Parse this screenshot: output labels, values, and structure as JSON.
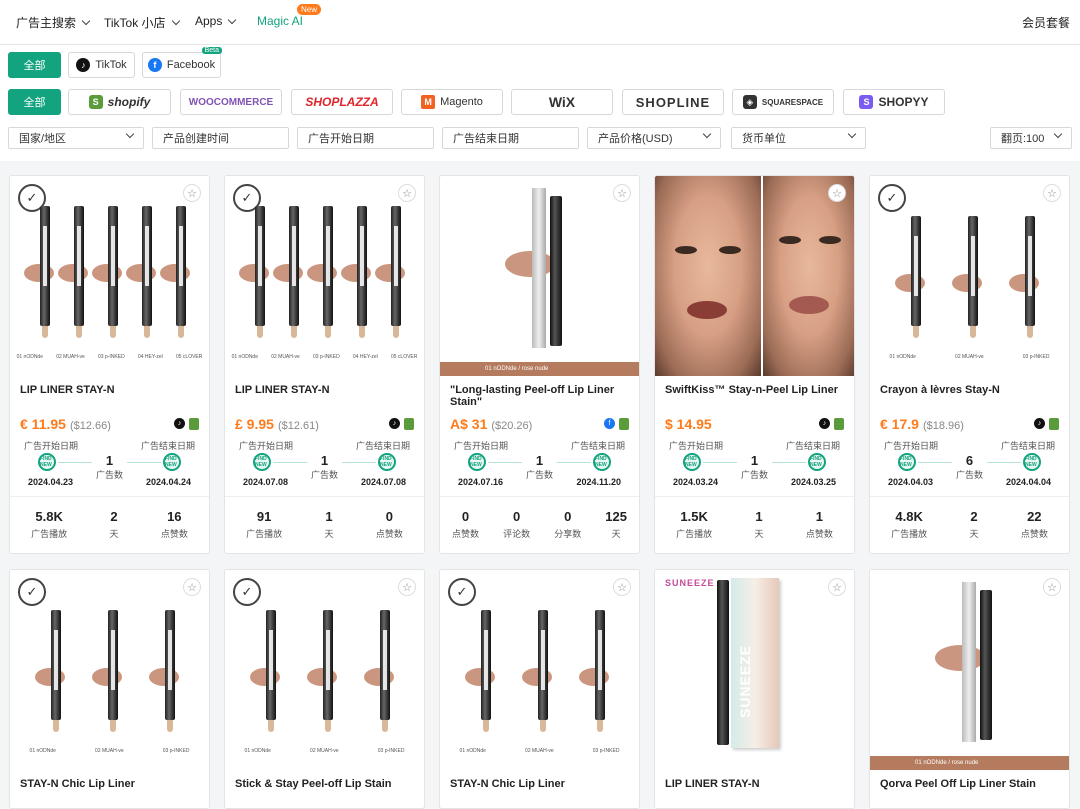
{
  "nav": {
    "items": [
      {
        "label": "广告主搜索"
      },
      {
        "label": "TikTok 小店"
      },
      {
        "label": "Apps"
      },
      {
        "label": "Magic AI"
      }
    ],
    "new_badge": "New",
    "member": "会员套餐"
  },
  "filters": {
    "platform_all": "全部",
    "tiktok": "TikTok",
    "facebook": "Facebook",
    "beta": "Beta",
    "store_all": "全部",
    "stores": [
      "shopify",
      "WOOCOMMERCE",
      "SHOPLAZZA",
      "Magento",
      "WiX",
      "SHOPLINE",
      "SQUARESPACE",
      "SHOPYY"
    ],
    "selects": {
      "region": "国家/地区",
      "created": "产品创建时间",
      "ad_start": "广告开始日期",
      "ad_end": "广告结束日期",
      "price": "产品价格(USD)",
      "currency": "货币单位",
      "per_page": "翻页:100"
    }
  },
  "colors": {
    "accent": "#14a37f",
    "price": "#ff7a1a"
  },
  "labels": {
    "start": "广告开始日期",
    "end": "广告结束日期",
    "ads": "广告数",
    "badge": "FIND NEW"
  },
  "cards": [
    {
      "title": "LIP LINER STAY-N",
      "price": "€ 11.95",
      "orig": "($12.66)",
      "plat": [
        "tiktok",
        "shopify"
      ],
      "count": "1",
      "d1": "2024.04.23",
      "d2": "2024.04.24",
      "stats": [
        {
          "v": "5.8K",
          "k": "广告播放"
        },
        {
          "v": "2",
          "k": "天"
        },
        {
          "v": "16",
          "k": "点赞数"
        }
      ]
    },
    {
      "title": "LIP LINER STAY-N",
      "price": "£ 9.95",
      "orig": "($12.61)",
      "plat": [
        "tiktok",
        "shopify"
      ],
      "count": "1",
      "d1": "2024.07.08",
      "d2": "2024.07.08",
      "stats": [
        {
          "v": "91",
          "k": "广告播放"
        },
        {
          "v": "1",
          "k": "天"
        },
        {
          "v": "0",
          "k": "点赞数"
        }
      ]
    },
    {
      "title": "\"Long-lasting Peel-off Lip Liner Stain\"",
      "price": "A$ 31",
      "orig": "($20.26)",
      "plat": [
        "facebook",
        "shopify"
      ],
      "count": "1",
      "d1": "2024.07.16",
      "d2": "2024.11.20",
      "stats": [
        {
          "v": "0",
          "k": "点赞数"
        },
        {
          "v": "0",
          "k": "评论数"
        },
        {
          "v": "0",
          "k": "分享数"
        },
        {
          "v": "125",
          "k": "天"
        }
      ],
      "bar": "01 nODNde / rose nude"
    },
    {
      "title": "SwiftKiss™ Stay-n-Peel Lip Liner",
      "price": "$ 14.95",
      "orig": "",
      "plat": [
        "tiktok",
        "shopify"
      ],
      "count": "1",
      "d1": "2024.03.24",
      "d2": "2024.03.25",
      "stats": [
        {
          "v": "1.5K",
          "k": "广告播放"
        },
        {
          "v": "1",
          "k": "天"
        },
        {
          "v": "1",
          "k": "点赞数"
        }
      ]
    },
    {
      "title": "Crayon à lèvres Stay-N",
      "price": "€ 17.9",
      "orig": "($18.96)",
      "plat": [
        "tiktok",
        "shopify"
      ],
      "count": "6",
      "d1": "2024.04.03",
      "d2": "2024.04.04",
      "stats": [
        {
          "v": "4.8K",
          "k": "广告播放"
        },
        {
          "v": "2",
          "k": "天"
        },
        {
          "v": "22",
          "k": "点赞数"
        }
      ]
    },
    {
      "title": "STAY-N Chic Lip Liner"
    },
    {
      "title": "Stick & Stay Peel-off Lip Stain"
    },
    {
      "title": "STAY-N Chic Lip Liner"
    },
    {
      "title": "LIP LINER STAY-N",
      "brand": "SUNEEZE",
      "box": "SUNEEZE"
    },
    {
      "title": "Qorva Peel Off Lip Liner Stain",
      "bar": "01 nODNde / rose nude"
    }
  ],
  "shade_caps": [
    "01 nODNde",
    "02 MUAH-ve",
    "03 p-INKED",
    "04 HEY-zel",
    "05 cLOVER"
  ]
}
